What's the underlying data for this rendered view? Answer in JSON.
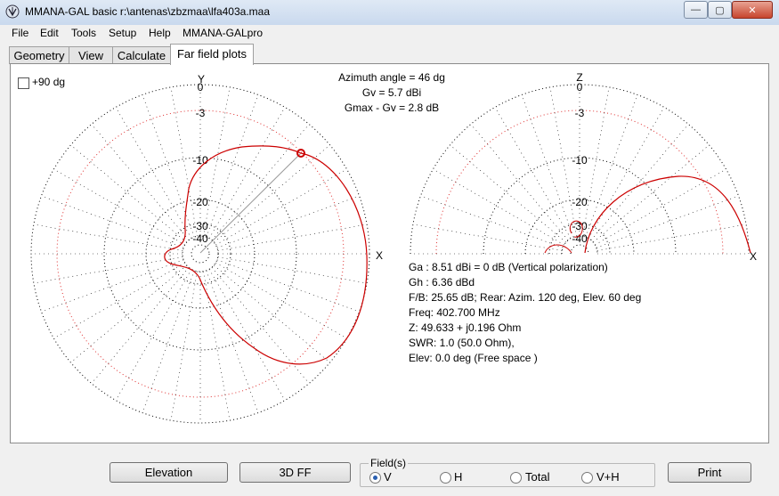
{
  "window": {
    "title": "MMANA-GAL basic r:\\antenas\\zbzmaa\\lfa403a.maa",
    "minimize_label": "—",
    "maximize_label": "▢",
    "close_label": "✕"
  },
  "menu": {
    "items": [
      "File",
      "Edit",
      "Tools",
      "Setup",
      "Help",
      "MMANA-GALpro"
    ]
  },
  "tabs": [
    {
      "label": "Geometry"
    },
    {
      "label": "View"
    },
    {
      "label": "Calculate"
    },
    {
      "label": "Far field plots",
      "active": true
    }
  ],
  "options": {
    "plus90_label": "+90 dg",
    "plus90_checked": false
  },
  "plot_header": {
    "azimuth": "Azimuth angle = 46 dg",
    "gv": "Gv = 5.7 dBi",
    "gmax": "Gmax - Gv = 2.8 dB"
  },
  "left_plot": {
    "y_label": "Y",
    "x_label": "X",
    "ring_labels": [
      "0",
      "-3",
      "-10",
      "-20",
      "-30",
      "-40"
    ]
  },
  "right_plot": {
    "z_label": "Z",
    "x_label": "X",
    "ring_labels": [
      "0",
      "-3",
      "-10",
      "-20",
      "-30",
      "-40"
    ]
  },
  "results": {
    "ga": "Ga : 8.51 dBi = 0 dB  (Vertical polarization)",
    "gh": "Gh : 6.36 dBd",
    "fb": "F/B: 25.65 dB; Rear: Azim. 120 deg,  Elev. 60 deg",
    "freq": "Freq: 402.700 MHz",
    "z": "Z: 49.633 + j0.196 Ohm",
    "swr": "SWR: 1.0 (50.0 Ohm),",
    "elev": "Elev: 0.0 deg (Free space )"
  },
  "buttons": {
    "elevation": "Elevation",
    "ff3d": "3D FF",
    "print": "Print"
  },
  "field": {
    "legend": "Field(s)",
    "options": [
      "V",
      "H",
      "Total",
      "V+H"
    ],
    "selected": "V"
  },
  "colors": {
    "pattern": "#cc0000",
    "grid": "#000000",
    "grid_minus3": "#e03030"
  }
}
